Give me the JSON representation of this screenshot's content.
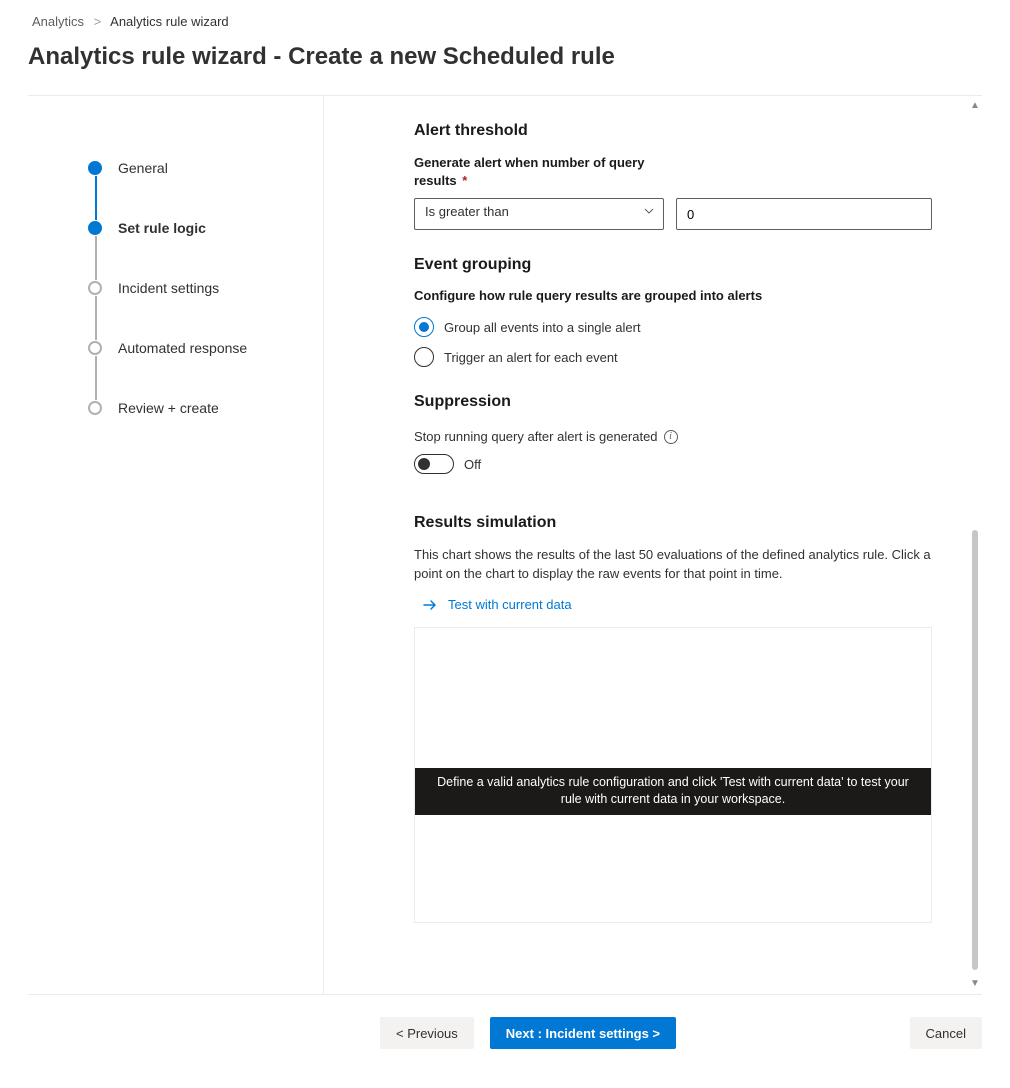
{
  "breadcrumb": {
    "root": "Analytics",
    "current": "Analytics rule wizard"
  },
  "page_title": "Analytics rule wizard - Create a new Scheduled rule",
  "steps": [
    {
      "label": "General"
    },
    {
      "label": "Set rule logic"
    },
    {
      "label": "Incident settings"
    },
    {
      "label": "Automated response"
    },
    {
      "label": "Review + create"
    }
  ],
  "threshold": {
    "section_title": "Alert threshold",
    "field_label": "Generate alert when number of query results",
    "required_mark": "*",
    "operator": "Is greater than",
    "value": "0"
  },
  "grouping": {
    "section_title": "Event grouping",
    "subhead": "Configure how rule query results are grouped into alerts",
    "option_single": "Group all events into a single alert",
    "option_each": "Trigger an alert for each event"
  },
  "suppression": {
    "section_title": "Suppression",
    "label": "Stop running query after alert is generated",
    "state": "Off"
  },
  "results": {
    "section_title": "Results simulation",
    "description": "This chart shows the results of the last 50 evaluations of the defined analytics rule. Click a point on the chart to display the raw events for that point in time.",
    "test_link": "Test with current data",
    "chart_message": "Define a valid analytics rule configuration and click 'Test with current data' to test your rule with current data in your workspace."
  },
  "footer": {
    "previous": "< Previous",
    "next": "Next : Incident settings >",
    "cancel": "Cancel"
  }
}
